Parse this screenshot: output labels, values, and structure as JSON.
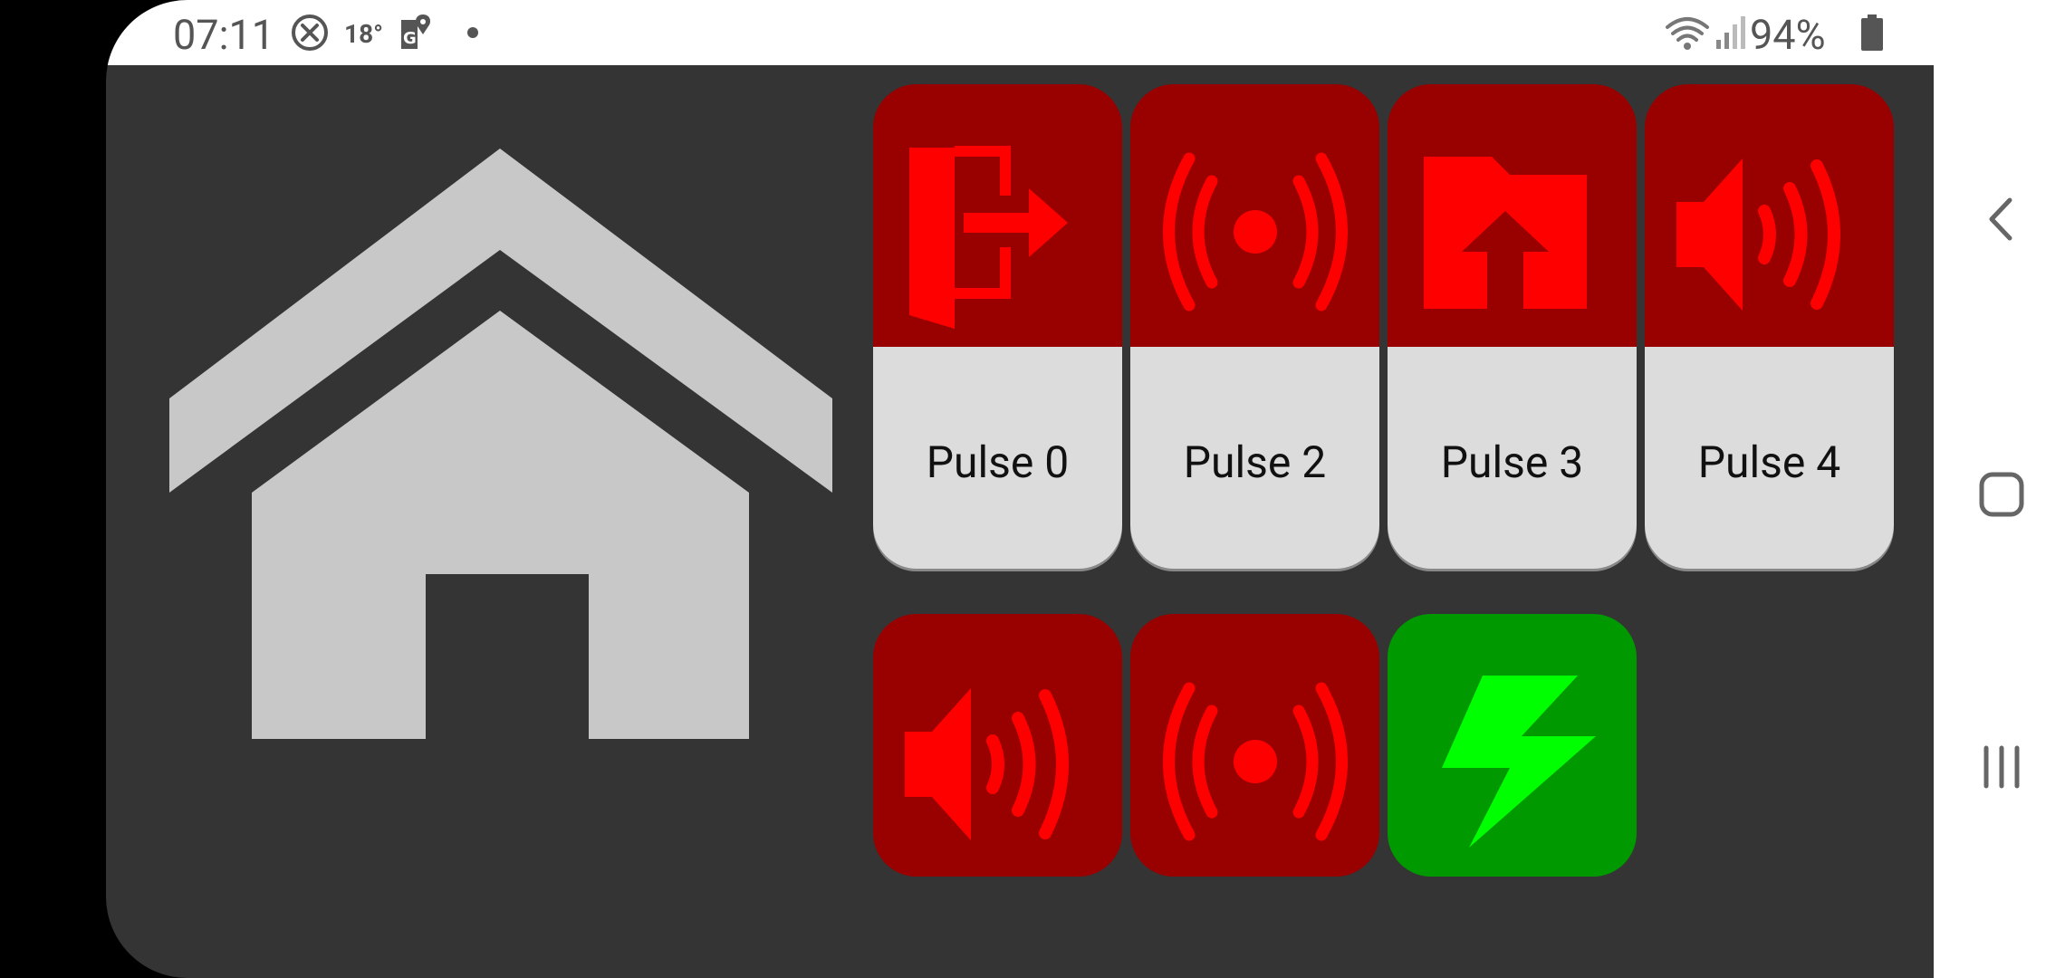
{
  "statusbar": {
    "time": "07:11",
    "temperature": "18°",
    "battery": "94%",
    "icons": [
      "no-disturb-icon",
      "weather-temp",
      "map-pin-icon",
      "dot-icon",
      "wifi-icon",
      "signal-icon",
      "battery-icon"
    ]
  },
  "home": {
    "icon": "home-icon",
    "color": "#c8c8c8"
  },
  "tiles": [
    {
      "label": "Pulse 0",
      "icon": "exit-door-icon",
      "state_color": "#990000",
      "icon_color": "#ff0000"
    },
    {
      "label": "Pulse 2",
      "icon": "broadcast-icon",
      "state_color": "#990000",
      "icon_color": "#ff0000"
    },
    {
      "label": "Pulse 3",
      "icon": "folder-upload-icon",
      "state_color": "#990000",
      "icon_color": "#ff0000"
    },
    {
      "label": "Pulse 4",
      "icon": "speaker-icon",
      "state_color": "#990000",
      "icon_color": "#ff0000"
    }
  ],
  "square_tiles": [
    {
      "icon": "speaker-icon",
      "state_color": "#990000",
      "icon_color": "#ff0000"
    },
    {
      "icon": "broadcast-icon",
      "state_color": "#990000",
      "icon_color": "#ff0000"
    },
    {
      "icon": "lightning-bolt-icon",
      "state_color": "#009900",
      "icon_color": "#00ff00"
    }
  ],
  "navigation": {
    "buttons": [
      "back-button",
      "home-button",
      "recents-button"
    ]
  }
}
